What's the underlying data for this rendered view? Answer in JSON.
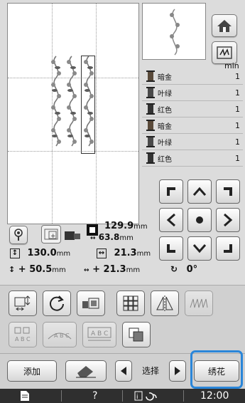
{
  "threads": [
    {
      "name": "暗金",
      "count": "1",
      "color": "#5a4a3a"
    },
    {
      "name": "叶绿",
      "count": "1",
      "color": "#4a4a4a"
    },
    {
      "name": "红色",
      "count": "1",
      "color": "#333333"
    },
    {
      "name": "暗金",
      "count": "1",
      "color": "#5a4a3a"
    },
    {
      "name": "叶绿",
      "count": "1",
      "color": "#4a4a4a"
    },
    {
      "name": "红色",
      "count": "1",
      "color": "#333333"
    }
  ],
  "min_label": "min",
  "size": {
    "height_value": "129.9",
    "height_unit": "mm",
    "width_value": "63.8",
    "width_unit": "mm",
    "pattern_height": "130.0",
    "pattern_width": "21.3",
    "offset_v_prefix": "+",
    "offset_v": "50.5",
    "offset_h_prefix": "+",
    "offset_h": "21.3",
    "rotation": "0°",
    "unit": "mm"
  },
  "buttons": {
    "add": "添加",
    "select": "选择",
    "embroider": "绣花"
  },
  "status": {
    "help": "?",
    "time": "12:00"
  },
  "accent_color": "#2a86d9"
}
